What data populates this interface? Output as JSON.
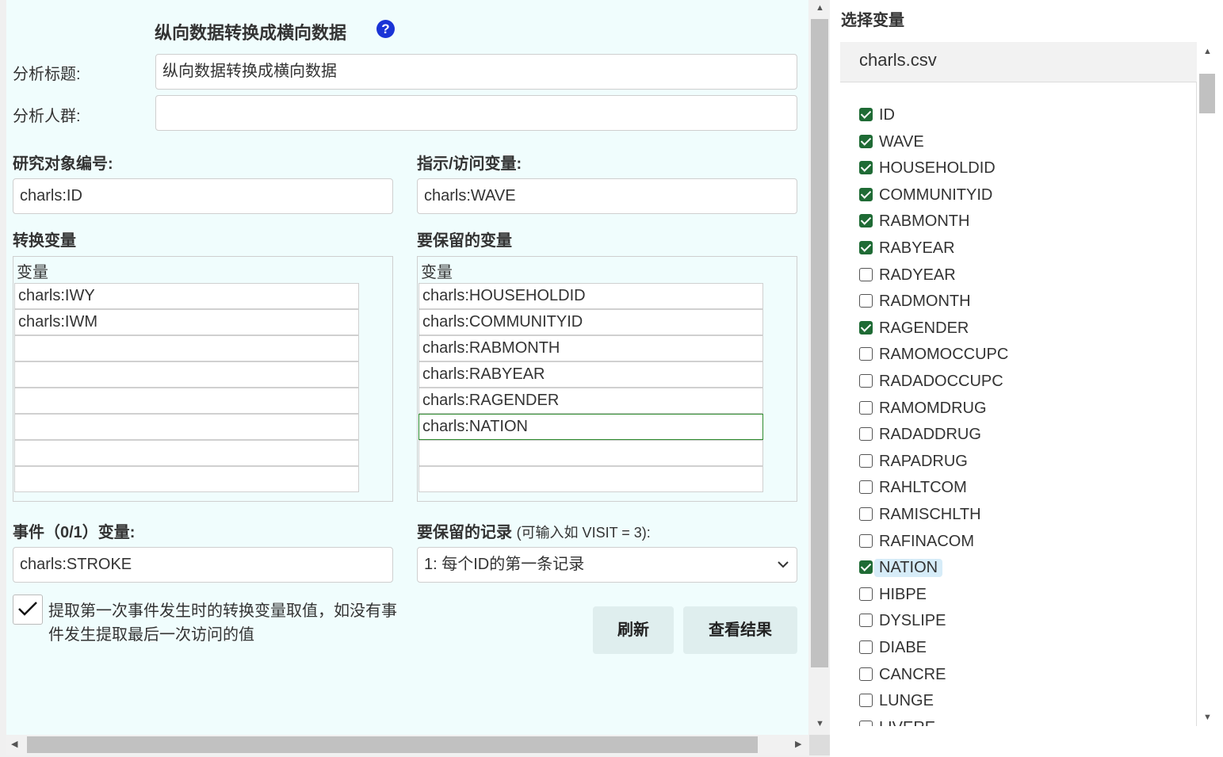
{
  "form": {
    "title": "纵向数据转换成横向数据",
    "help_icon": "?",
    "analysis_title_label": "分析标题:",
    "analysis_title_value": "纵向数据转换成横向数据",
    "analysis_group_label": "分析人群:",
    "analysis_group_value": "",
    "subject_id_label": "研究对象编号:",
    "subject_id_value": "charls:ID",
    "visit_var_label": "指示/访问变量:",
    "visit_var_value": "charls:WAVE",
    "convert_vars_label": "转换变量",
    "convert_vars_header": "变量",
    "convert_vars": [
      "charls:IWY",
      "charls:IWM",
      "",
      "",
      "",
      "",
      "",
      ""
    ],
    "keep_vars_label": "要保留的变量",
    "keep_vars_header": "变量",
    "keep_vars": [
      "charls:HOUSEHOLDID",
      "charls:COMMUNITYID",
      "charls:RABMONTH",
      "charls:RABYEAR",
      "charls:RAGENDER",
      "charls:NATION",
      "",
      ""
    ],
    "event_var_label": "事件（0/1）变量:",
    "event_var_value": "charls:STROKE",
    "keep_records_label": "要保留的记录",
    "keep_records_hint": "(可输入如 VISIT = 3):",
    "keep_records_value": "1: 每个ID的第一条记录",
    "extract_first_checkbox_label": "提取第一次事件发生时的转换变量取值，如没有事件发生提取最后一次访问的值",
    "extract_first_checked": true,
    "refresh_button": "刷新",
    "view_results_button": "查看结果"
  },
  "variable_panel": {
    "title": "选择变量",
    "file_name": "charls.csv",
    "variables": [
      {
        "name": "ID",
        "checked": true
      },
      {
        "name": "WAVE",
        "checked": true
      },
      {
        "name": "HOUSEHOLDID",
        "checked": true
      },
      {
        "name": "COMMUNITYID",
        "checked": true
      },
      {
        "name": "RABMONTH",
        "checked": true
      },
      {
        "name": "RABYEAR",
        "checked": true
      },
      {
        "name": "RADYEAR",
        "checked": false
      },
      {
        "name": "RADMONTH",
        "checked": false
      },
      {
        "name": "RAGENDER",
        "checked": true
      },
      {
        "name": "RAMOMOCCUPC",
        "checked": false
      },
      {
        "name": "RADADOCCUPC",
        "checked": false
      },
      {
        "name": "RAMOMDRUG",
        "checked": false
      },
      {
        "name": "RADADDRUG",
        "checked": false
      },
      {
        "name": "RAPADRUG",
        "checked": false
      },
      {
        "name": "RAHLTCOM",
        "checked": false
      },
      {
        "name": "RAMISCHLTH",
        "checked": false
      },
      {
        "name": "RAFINACOM",
        "checked": false
      },
      {
        "name": "NATION",
        "checked": true,
        "highlighted": true
      },
      {
        "name": "HIBPE",
        "checked": false
      },
      {
        "name": "DYSLIPE",
        "checked": false
      },
      {
        "name": "DIABE",
        "checked": false
      },
      {
        "name": "CANCRE",
        "checked": false
      },
      {
        "name": "LUNGE",
        "checked": false
      },
      {
        "name": "LIVERE",
        "checked": false
      }
    ]
  },
  "colors": {
    "form_background": "#f0fdfd",
    "checkbox_checked": "#1f6b35",
    "help_icon": "#1a34d6",
    "button_background": "#dfeeee",
    "highlight": "#d6ecf8"
  }
}
